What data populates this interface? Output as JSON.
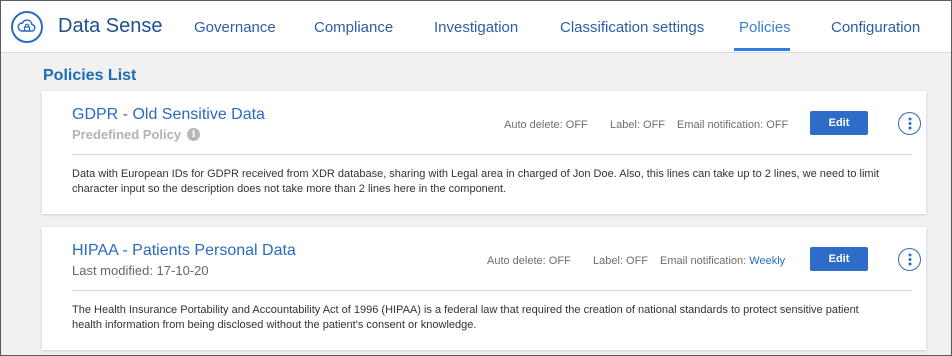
{
  "app": {
    "title": "Data Sense",
    "icon": "cloud-lock-icon"
  },
  "nav": {
    "items": [
      {
        "label": "Governance",
        "active": false
      },
      {
        "label": "Compliance",
        "active": false
      },
      {
        "label": "Investigation",
        "active": false
      },
      {
        "label": "Classification settings",
        "active": false
      },
      {
        "label": "Policies",
        "active": true
      },
      {
        "label": "Configuration",
        "active": false
      }
    ]
  },
  "page": {
    "title": "Policies List"
  },
  "policies": [
    {
      "name": "GDPR - Old Sensitive Data",
      "subtitle": "Predefined Policy",
      "auto_delete": "Auto delete: OFF",
      "label": "Label: OFF",
      "email_notification_label": "Email notification:",
      "email_notification_value": "OFF",
      "edit_label": "Edit",
      "description": "Data with European IDs for GDPR received from XDR database, sharing with Legal area in charged of Jon Doe. Also, this lines can take up to 2 lines, we need to limit character input so the description does not take more than 2 lines here in the component."
    },
    {
      "name": "HIPAA - Patients Personal Data",
      "subtitle": "Last modified: 17-10-20",
      "auto_delete": "Auto delete: OFF",
      "label": "Label: OFF",
      "email_notification_label": "Email notification:",
      "email_notification_value": "Weekly",
      "edit_label": "Edit",
      "description": "The Health Insurance Portability and Accountability Act of 1996 (HIPAA) is a federal law that required the creation of national standards to protect sensitive patient health information from being disclosed without the patient's consent or knowledge."
    }
  ],
  "colors": {
    "accent": "#2a6bbf",
    "button": "#2e6cc8",
    "title": "#1b6db5"
  }
}
